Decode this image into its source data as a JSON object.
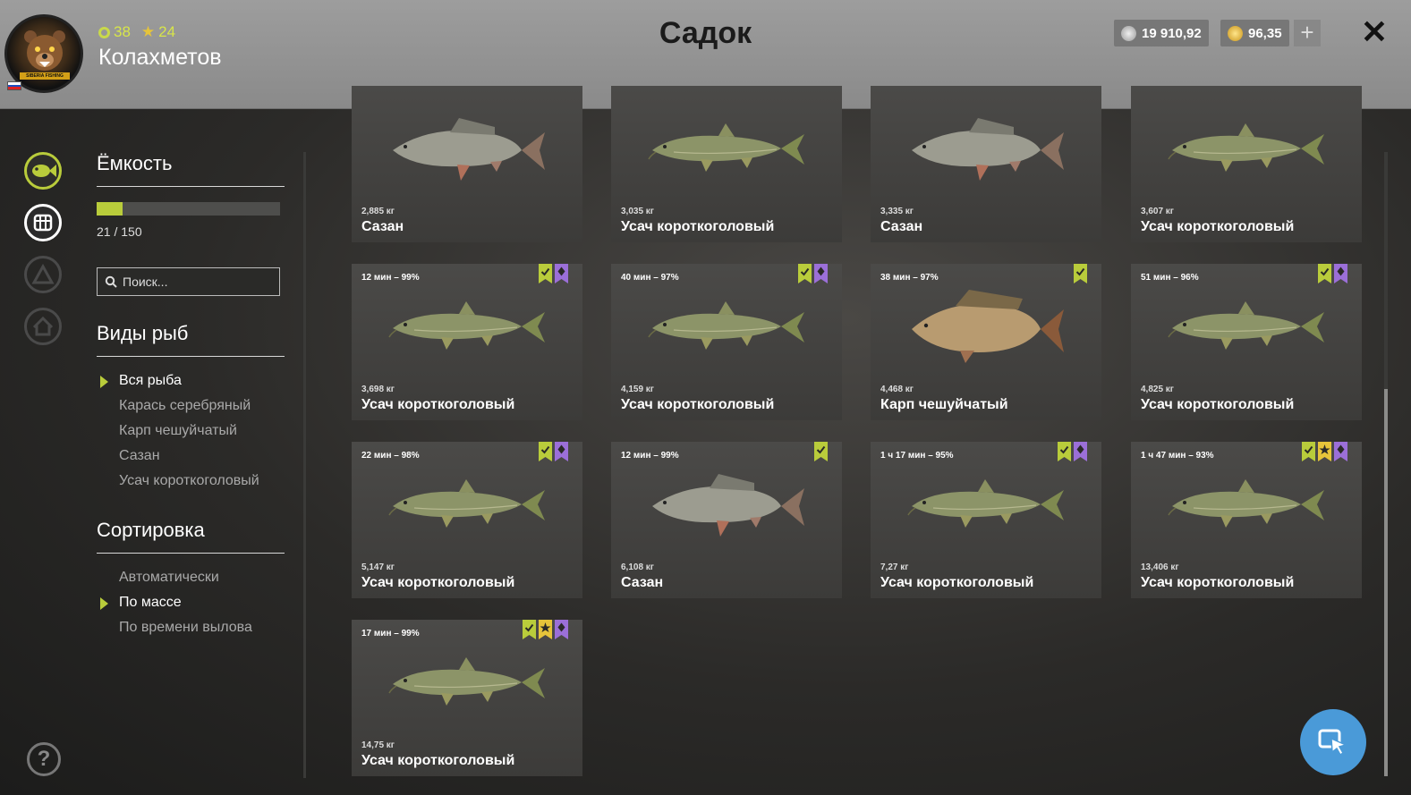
{
  "header": {
    "title": "Садок",
    "username": "Колахметов",
    "level": "38",
    "stars": "24",
    "silver": "19 910,92",
    "gold": "96,35",
    "avatar_text": "SIBERIA FISHING",
    "add_label": "+",
    "close_label": "✕"
  },
  "sidebar": {
    "capacity_title": "Ёмкость",
    "capacity_text": "21 / 150",
    "capacity_fraction": 0.14,
    "search_placeholder": "Поиск...",
    "species_title": "Виды рыб",
    "species": [
      "Вся рыба",
      "Карась серебряный",
      "Карп чешуйчатый",
      "Сазан",
      "Усач короткоголовый"
    ],
    "species_selected": 0,
    "sort_title": "Сортировка",
    "sort_options": [
      "Автоматически",
      "По массе",
      "По времени вылова"
    ],
    "sort_selected": 1,
    "help_label": "?"
  },
  "fish": [
    {
      "meta": "",
      "weight": "2,885 кг",
      "name": "Сазан",
      "kind": "carp",
      "badges": []
    },
    {
      "meta": "",
      "weight": "3,035 кг",
      "name": "Усач короткоголовый",
      "kind": "barbel",
      "badges": []
    },
    {
      "meta": "",
      "weight": "3,335 кг",
      "name": "Сазан",
      "kind": "carp",
      "badges": []
    },
    {
      "meta": "",
      "weight": "3,607 кг",
      "name": "Усач короткоголовый",
      "kind": "barbel",
      "badges": []
    },
    {
      "meta": "12 мин – 99%",
      "weight": "3,698 кг",
      "name": "Усач короткоголовый",
      "kind": "barbel",
      "badges": [
        "check",
        "diamond"
      ]
    },
    {
      "meta": "40 мин – 97%",
      "weight": "4,159 кг",
      "name": "Усач короткоголовый",
      "kind": "barbel",
      "badges": [
        "check",
        "diamond"
      ]
    },
    {
      "meta": "38 мин – 97%",
      "weight": "4,468 кг",
      "name": "Карп чешуйчатый",
      "kind": "mirror",
      "badges": [
        "check"
      ]
    },
    {
      "meta": "51 мин – 96%",
      "weight": "4,825 кг",
      "name": "Усач короткоголовый",
      "kind": "barbel",
      "badges": [
        "check",
        "diamond"
      ]
    },
    {
      "meta": "22 мин – 98%",
      "weight": "5,147 кг",
      "name": "Усач короткоголовый",
      "kind": "barbel",
      "badges": [
        "check",
        "diamond"
      ]
    },
    {
      "meta": "12 мин – 99%",
      "weight": "6,108 кг",
      "name": "Сазан",
      "kind": "carp",
      "badges": [
        "check"
      ]
    },
    {
      "meta": "1 ч 17 мин – 95%",
      "weight": "7,27 кг",
      "name": "Усач короткоголовый",
      "kind": "barbel",
      "badges": [
        "check",
        "diamond"
      ]
    },
    {
      "meta": "1 ч 47 мин – 93%",
      "weight": "13,406 кг",
      "name": "Усач короткоголовый",
      "kind": "barbel",
      "badges": [
        "check",
        "star",
        "diamond"
      ]
    },
    {
      "meta": "17 мин – 99%",
      "weight": "14,75 кг",
      "name": "Усач короткоголовый",
      "kind": "barbel",
      "badges": [
        "check",
        "star",
        "diamond"
      ]
    }
  ],
  "colors": {
    "accent": "#b9cc3b",
    "badge_check": "#b9cc3b",
    "badge_star": "#e6c43a",
    "badge_diamond": "#9b6fd8",
    "cursor_button": "#4a9ad8"
  },
  "icons": {
    "nav": [
      "fish-icon",
      "keepnet-icon",
      "camp-icon",
      "home-icon"
    ],
    "currency": [
      "silver-coin-icon",
      "gold-coin-icon"
    ],
    "fab": "cursor-icon"
  }
}
